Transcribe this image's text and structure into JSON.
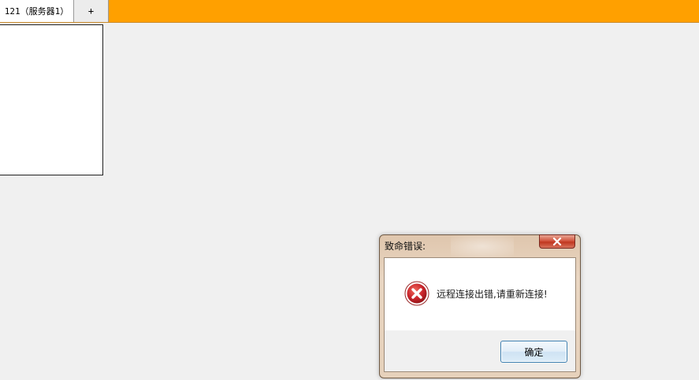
{
  "tabs": {
    "active_label": "121（服务器1）",
    "add_label": "+"
  },
  "dialog": {
    "title": "致命错误:",
    "message": "远程连接出错,请重新连接!",
    "ok_label": "确定",
    "close_symbol": "✕",
    "icon": "error-icon"
  },
  "colors": {
    "topbar": "#ffa000",
    "error_red": "#c8232a",
    "button_border": "#3c7fb1"
  }
}
